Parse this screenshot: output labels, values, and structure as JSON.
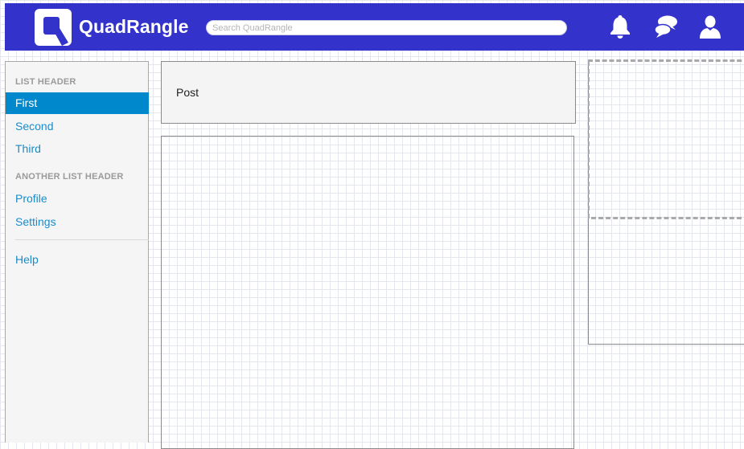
{
  "header": {
    "brand": "QuadRangle",
    "search_placeholder": "Search QuadRangle",
    "icons": [
      "bell-icon",
      "chat-bubbles-icon",
      "user-icon"
    ]
  },
  "sidebar": {
    "sections": [
      {
        "header": "LIST HEADER",
        "items": [
          {
            "label": "First",
            "active": true
          },
          {
            "label": "Second",
            "active": false
          },
          {
            "label": "Third",
            "active": false
          }
        ]
      },
      {
        "header": "ANOTHER LIST HEADER",
        "items": [
          {
            "label": "Profile",
            "active": false
          },
          {
            "label": "Settings",
            "active": false
          }
        ]
      },
      {
        "header": "",
        "items": [
          {
            "label": "Help",
            "active": false
          }
        ]
      }
    ]
  },
  "main": {
    "post_label": "Post"
  },
  "colors": {
    "topbar": "#3333cc",
    "active_item": "#0088cc",
    "link": "#1a8cc8"
  }
}
